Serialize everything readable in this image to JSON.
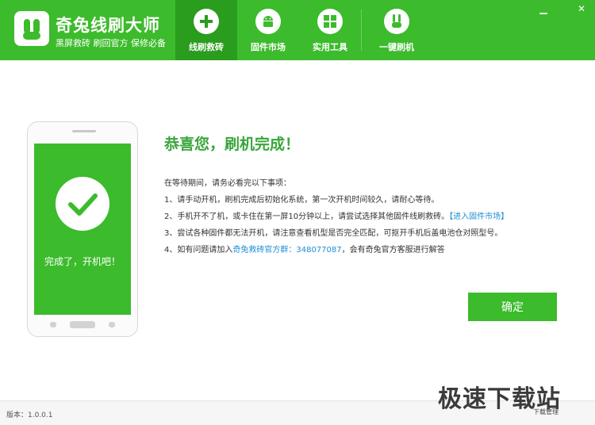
{
  "app": {
    "title": "奇兔线刷大师",
    "subtitle": "黑屏救砖  刷回官方  保修必备"
  },
  "tabs": [
    {
      "label": "线刷救砖",
      "icon": "plus-grid-icon",
      "active": true
    },
    {
      "label": "固件市场",
      "icon": "android-icon",
      "active": false
    },
    {
      "label": "实用工具",
      "icon": "grid-icon",
      "active": false
    },
    {
      "label": "一键刷机",
      "icon": "rabbit-icon",
      "active": false
    }
  ],
  "window": {
    "minimize": "▁",
    "close": "✕"
  },
  "phone": {
    "status_text": "完成了，开机吧！",
    "icon": "check-icon"
  },
  "main": {
    "heading": "恭喜您，刷机完成！",
    "intro": "在等待期间，请务必看完以下事项：",
    "item1": "1、请手动开机，刷机完成后初始化系统，第一次开机时间较久，请耐心等待。",
    "item2_text": "2、手机开不了机，或卡住在第一屏10分钟以上，请尝试选择其他固件线刷救砖。",
    "item2_link": "【进入固件市场】",
    "item3": "3、尝试各种固件都无法开机，请注意查看机型是否完全匹配，可抠开手机后盖电池仓对照型号。",
    "item4_pre": "4、如有问题请加入",
    "item4_link": "奇兔救砖官方群：348077087",
    "item4_post": "，会有奇兔官方客服进行解答",
    "confirm_label": "确定"
  },
  "footer": {
    "version": "版本：1.0.0.1"
  },
  "watermark": {
    "main": "极速下载站",
    "sub": "下载管理"
  },
  "colors": {
    "brand_green": "#3cbb2c",
    "active_tab": "#2a9c1e",
    "heading_green": "#3aa63c",
    "link_blue": "#1e8fd6"
  }
}
